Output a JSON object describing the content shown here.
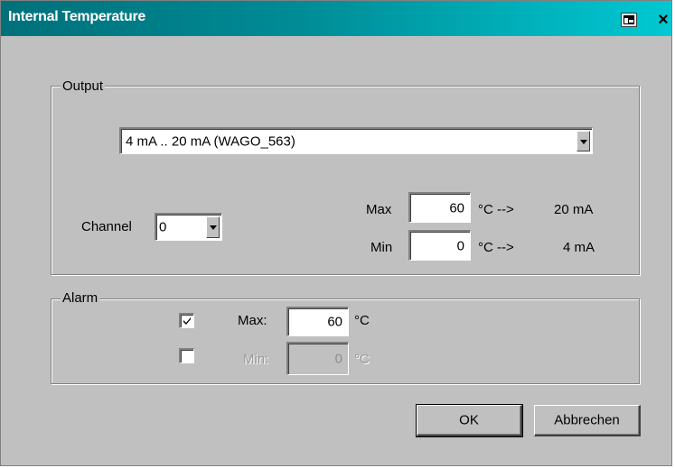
{
  "window": {
    "title": "Internal Temperature"
  },
  "output": {
    "legend": "Output",
    "type_select_value": "4 mA .. 20 mA (WAGO_563)",
    "channel_label": "Channel",
    "channel_value": "0",
    "max_label": "Max",
    "max_value": "60",
    "max_unit": "°C -->",
    "max_ma": "20 mA",
    "min_label": "Min",
    "min_value": "0",
    "min_unit": "°C -->",
    "min_ma": "4 mA"
  },
  "alarm": {
    "legend": "Alarm",
    "max_checked": true,
    "max_label": "Max:",
    "max_value": "60",
    "max_unit": "°C",
    "min_checked": false,
    "min_label": "Min:",
    "min_value": "0",
    "min_unit": "°C"
  },
  "buttons": {
    "ok": "OK",
    "cancel": "Abbrechen"
  }
}
